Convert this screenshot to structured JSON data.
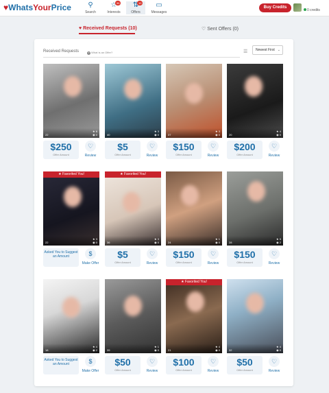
{
  "header": {
    "logo": {
      "part1": "Whats",
      "part2": "Your",
      "part3": "Price"
    },
    "nav": [
      {
        "label": "Search",
        "icon": "search-icon",
        "badge": ""
      },
      {
        "label": "Interests",
        "icon": "star-icon",
        "badge": "96"
      },
      {
        "label": "Offers",
        "icon": "offers-icon",
        "badge": "10"
      },
      {
        "label": "Messages",
        "icon": "messages-icon",
        "badge": ""
      }
    ],
    "buy_credits": "Buy Credits",
    "credits": "0 credits"
  },
  "tabs": {
    "received": "Received Requests (10)",
    "sent": "Sent Offers (0)"
  },
  "panel": {
    "title": "Received Requests",
    "what_is": "What is an Offer?",
    "sort": "Newest First"
  },
  "labels": {
    "offer_amount": "Offer Amount",
    "review": "Review",
    "make_offer": "Make Offer",
    "favorited": "Favorited You!"
  },
  "cards": [
    {
      "age": "22",
      "stat1": "6",
      "stat2": "0",
      "favorited": false,
      "ask": false,
      "amount": "$250",
      "ask_text": ""
    },
    {
      "age": "40",
      "stat1": "3",
      "stat2": "0",
      "favorited": false,
      "ask": false,
      "amount": "$5",
      "ask_text": ""
    },
    {
      "age": "37",
      "stat1": "3",
      "stat2": "0",
      "favorited": false,
      "ask": false,
      "amount": "$150",
      "ask_text": ""
    },
    {
      "age": "20",
      "stat1": "4",
      "stat2": "0",
      "favorited": false,
      "ask": false,
      "amount": "$200",
      "ask_text": ""
    },
    {
      "age": "22",
      "stat1": "3",
      "stat2": "0",
      "favorited": true,
      "ask": true,
      "amount": "",
      "ask_text": "Asked You to Suggest an Amount"
    },
    {
      "age": "36",
      "stat1": "3",
      "stat2": "0",
      "favorited": true,
      "ask": false,
      "amount": "$5",
      "ask_text": ""
    },
    {
      "age": "24",
      "stat1": "1",
      "stat2": "0",
      "favorited": false,
      "ask": false,
      "amount": "$150",
      "ask_text": ""
    },
    {
      "age": "28",
      "stat1": "5",
      "stat2": "2",
      "favorited": false,
      "ask": false,
      "amount": "$150",
      "ask_text": ""
    },
    {
      "age": "18",
      "stat1": "4",
      "stat2": "2",
      "favorited": false,
      "ask": true,
      "amount": "",
      "ask_text": "Asked You to Suggest an Amount"
    },
    {
      "age": "39",
      "stat1": "1",
      "stat2": "0",
      "favorited": false,
      "ask": false,
      "amount": "$50",
      "ask_text": ""
    },
    {
      "age": "21",
      "stat1": "4",
      "stat2": "0",
      "favorited": true,
      "ask": false,
      "amount": "$100",
      "ask_text": ""
    },
    {
      "age": "32",
      "stat1": "4",
      "stat2": "0",
      "favorited": false,
      "ask": false,
      "amount": "$50",
      "ask_text": ""
    }
  ],
  "colors": {
    "brand_blue": "#1f6fa8",
    "brand_red": "#c8232c"
  }
}
